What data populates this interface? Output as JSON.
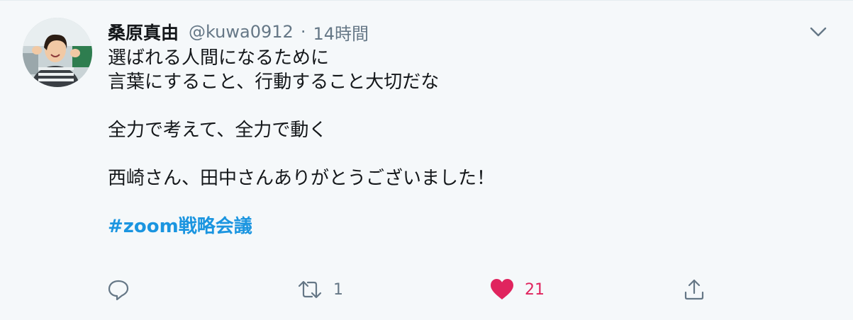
{
  "tweet": {
    "display_name": "桑原真由",
    "handle": "@kuwa0912",
    "separator": "·",
    "time": "14時間",
    "lines": [
      "選ばれる人間になるために",
      "言葉にすること、行動すること大切だな",
      "",
      "全力で考えて、全力で動く",
      "",
      "西崎さん、田中さんありがとうございました！",
      ""
    ],
    "hashtag": "#zoom戦略会議"
  },
  "actions": {
    "reply_count": "",
    "retweet_count": "1",
    "like_count": "21",
    "share_count": ""
  },
  "colors": {
    "background": "#f5f8fa",
    "text": "#14171a",
    "secondary": "#657786",
    "link": "#1b95e0",
    "like": "#e0245e"
  },
  "icons": [
    "avatar-photo",
    "chevron-down-icon",
    "reply-icon",
    "retweet-icon",
    "heart-icon",
    "share-icon"
  ]
}
